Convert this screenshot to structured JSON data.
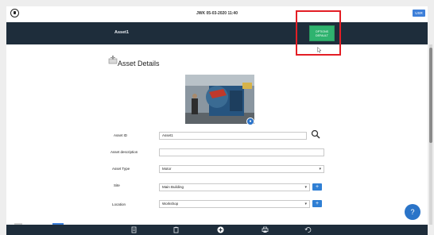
{
  "topbar": {
    "datetime": "JWK 05-03-2020 11:40",
    "user_label": "USR"
  },
  "header": {
    "title": "Asset1",
    "green_button_label": "OPTIONS DEFAULT"
  },
  "section": {
    "title": "Asset Details"
  },
  "form": {
    "asset_id_label": "Asset ID",
    "asset_id_value": "Asset1",
    "description_label": "Asset description",
    "description_value": "",
    "type_label": "Asset Type",
    "type_value": "Motor",
    "site_label": "Site",
    "site_value": "Main Building",
    "location_label": "Location",
    "location_value": "Workshop"
  },
  "help": {
    "label": "?"
  },
  "colors": {
    "header_bg": "#1e2d3b",
    "accent_blue": "#2f7fd4",
    "green_button": "#2fb36f",
    "highlight_red": "#e31e25"
  },
  "icons": {
    "bottombar": [
      "document-icon",
      "clipboard-icon",
      "plus-circle-icon",
      "print-icon",
      "undo-icon"
    ]
  }
}
